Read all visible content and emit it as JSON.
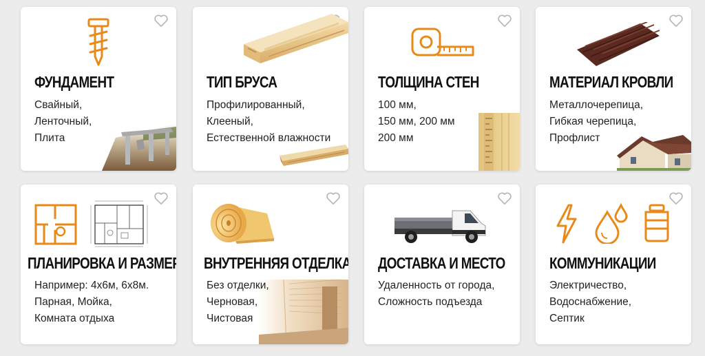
{
  "colors": {
    "accent": "#e88a1a",
    "card": "#ffffff",
    "background": "#ececec"
  },
  "cards": [
    {
      "title": "ФУНДАМЕНТ",
      "lines": [
        "Свайный,",
        "Ленточный,",
        "Плита"
      ],
      "icon": "screw-pile-icon"
    },
    {
      "title": "ТИП БРУСА",
      "lines": [
        "Профилированный,",
        "Клееный,",
        "Естественной влажности"
      ],
      "icon": "timber-beam-icon"
    },
    {
      "title": "ТОЛЩИНА СТЕН",
      "lines": [
        "100 мм,",
        "150 мм, 200 мм",
        "200 мм"
      ],
      "icon": "tape-measure-icon"
    },
    {
      "title": "МАТЕРИАЛ КРОВЛИ",
      "lines": [
        "Металлочерепица,",
        "Гибкая черепица,",
        "Профлист"
      ],
      "icon": "roof-sheet-icon"
    },
    {
      "title": "ПЛАНИРОВКА И РАЗМЕР",
      "lines": [
        "Например: 4х6м, 6х8м.",
        "Парная, Мойка,",
        "Комната отдыха"
      ],
      "icon": "floor-plan-icon"
    },
    {
      "title": "ВНУТРЕННЯЯ ОТДЕЛКА",
      "lines": [
        "Без отделки,",
        "Черновая,",
        "Чистовая"
      ],
      "icon": "insulation-roll-icon"
    },
    {
      "title": "ДОСТАВКА И МЕСТО",
      "lines": [
        "Удаленность от города,",
        "Сложность подъезда"
      ],
      "icon": "delivery-truck-icon"
    },
    {
      "title": "КОММУНИКАЦИИ",
      "lines": [
        "Электричество,",
        "Водоснабжение,",
        "Септик"
      ],
      "icon": "utilities-icon"
    }
  ]
}
